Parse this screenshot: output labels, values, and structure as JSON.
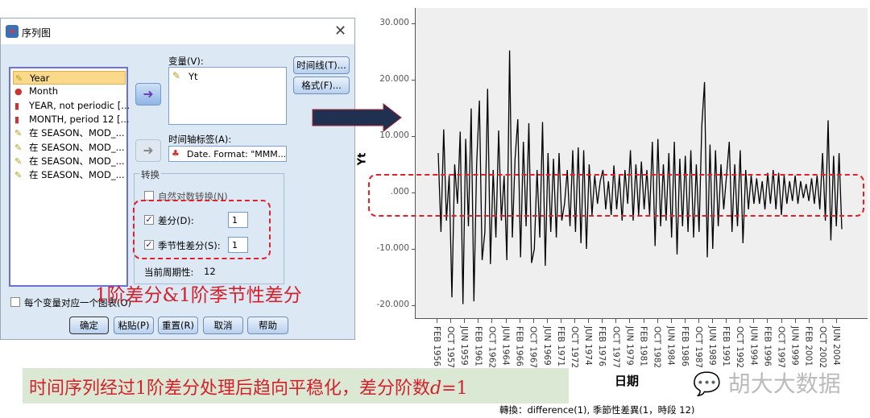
{
  "dialog": {
    "title": "序列图",
    "variables_list": [
      {
        "label": "Year",
        "icon": "scale-ruler-icon",
        "selected": true
      },
      {
        "label": "Month",
        "icon": "nominal-icon"
      },
      {
        "label": "YEAR, not periodic [...",
        "icon": "ordinal-bar-icon"
      },
      {
        "label": "MONTH, period 12 [...",
        "icon": "ordinal-bar-icon"
      },
      {
        "label": "在 SEASON、MOD_...",
        "icon": "scale-ruler-icon"
      },
      {
        "label": "在 SEASON、MOD_...",
        "icon": "scale-ruler-icon"
      },
      {
        "label": "在 SEASON、MOD_...",
        "icon": "scale-ruler-icon"
      },
      {
        "label": "在 SEASON、MOD_...",
        "icon": "scale-ruler-icon"
      }
    ],
    "variables_label": "变量(V):",
    "variables_value": "Yt",
    "time_axis_label": "时间轴标签(A):",
    "time_axis_value": "Date.  Format:  \"MMM...",
    "timeline_button": "时间线(T)...",
    "format_button": "格式(F)...",
    "transform_group": "转换",
    "natural_log": {
      "label": "自然对数转换(N)",
      "checked": false
    },
    "difference": {
      "label": "差分(D):",
      "checked": true,
      "value": "1"
    },
    "seasonal_difference": {
      "label": "季节性差分(S):",
      "checked": true,
      "value": "1"
    },
    "current_periodicity_label": "当前周期性:",
    "current_periodicity_value": "12",
    "one_chart_per_variable": {
      "label": "每个变量对应一个图表(O)",
      "checked": false
    },
    "buttons": {
      "ok": "确定",
      "paste": "粘贴(P)",
      "reset": "重置(R)",
      "cancel": "取消",
      "help": "帮助"
    }
  },
  "annotations": {
    "diff_note": "1阶差分&1阶季节性差分",
    "conclusion": "时间序列经过1阶差分处理后趋向平稳化，差分阶数",
    "conclusion_var": "d",
    "conclusion_eq": "=1",
    "watermark": "胡大大数据",
    "accent_red": "#e0202a",
    "arrow_color": "#1f3050"
  },
  "chart_data": {
    "type": "line",
    "ylabel": "Yt",
    "xlabel": "日期",
    "footnote": "轉換：difference(1), 季節性差異(1，時段 12)",
    "ylim": [
      -23,
      33
    ],
    "yticks": [
      "30.000",
      "20.000",
      "10.000",
      ".000",
      "-10.000",
      "-20.000"
    ],
    "ytick_values": [
      30,
      20,
      10,
      0,
      -10,
      -20
    ],
    "x_tick_labels": [
      "FEB 1956",
      "OCT 1957",
      "JUN 1959",
      "FEB 1961",
      "OCT 1962",
      "JUN 1964",
      "FEB 1966",
      "OCT 1967",
      "JUN 1969",
      "FEB 1971",
      "OCT 1972",
      "JUN 1974",
      "FEB 1976",
      "OCT 1977",
      "JUN 1979",
      "FEB 1981",
      "OCT 1982",
      "JUN 1984",
      "FEB 1986",
      "OCT 1987",
      "JUN 1989",
      "FEB 1991",
      "OCT 1992",
      "JUN 1994",
      "FEB 1996",
      "OCT 1997",
      "JUN 1999",
      "FEB 2001",
      "OCT 2002",
      "JUN 2004"
    ],
    "series": [
      {
        "values": [
          7,
          -7,
          11.2,
          -5,
          3,
          -18.6,
          5,
          -2,
          10.8,
          -19.8,
          9.5,
          -6,
          14.9,
          -19.3,
          5,
          16.3,
          -12,
          -7,
          18.4,
          -12.7,
          4,
          -8,
          11,
          -5,
          3,
          -12,
          25.2,
          -8,
          6,
          13,
          -11.5,
          9,
          -6,
          12.3,
          -12.5,
          -10,
          4,
          -8,
          12.5,
          -13,
          7,
          -7,
          6,
          -8,
          7,
          -5,
          -2,
          4,
          -6,
          7.5,
          -7,
          8,
          -9,
          7.5,
          -10,
          5,
          -4,
          3,
          -2,
          2,
          4,
          -3,
          2,
          -4,
          4.8,
          -3,
          3,
          -5,
          4,
          -2,
          7.5,
          -5,
          5,
          -4,
          5.5,
          -3,
          4,
          -4,
          9,
          -9.5,
          9.5,
          -6,
          5,
          -5,
          7,
          -8,
          9,
          -11,
          6,
          -6,
          6.5,
          -7,
          7.5,
          -8,
          5,
          -7,
          11.8,
          19.6,
          -11.5,
          8.5,
          -10,
          7.5,
          -6,
          5,
          -3,
          3,
          9,
          -7,
          5,
          -6,
          7.5,
          -9,
          4,
          -3,
          3,
          -2,
          2.5,
          -2,
          2,
          -3,
          3.5,
          -2,
          4,
          -3,
          3.5,
          -4,
          3,
          -2,
          2,
          -1.5,
          3,
          -2,
          2,
          -1,
          1.5,
          -1.5,
          2.5,
          -2,
          3,
          -3,
          7,
          -5,
          12.8,
          -8.5,
          6.5,
          -6,
          7,
          -6.5
        ]
      }
    ],
    "grid": false
  }
}
